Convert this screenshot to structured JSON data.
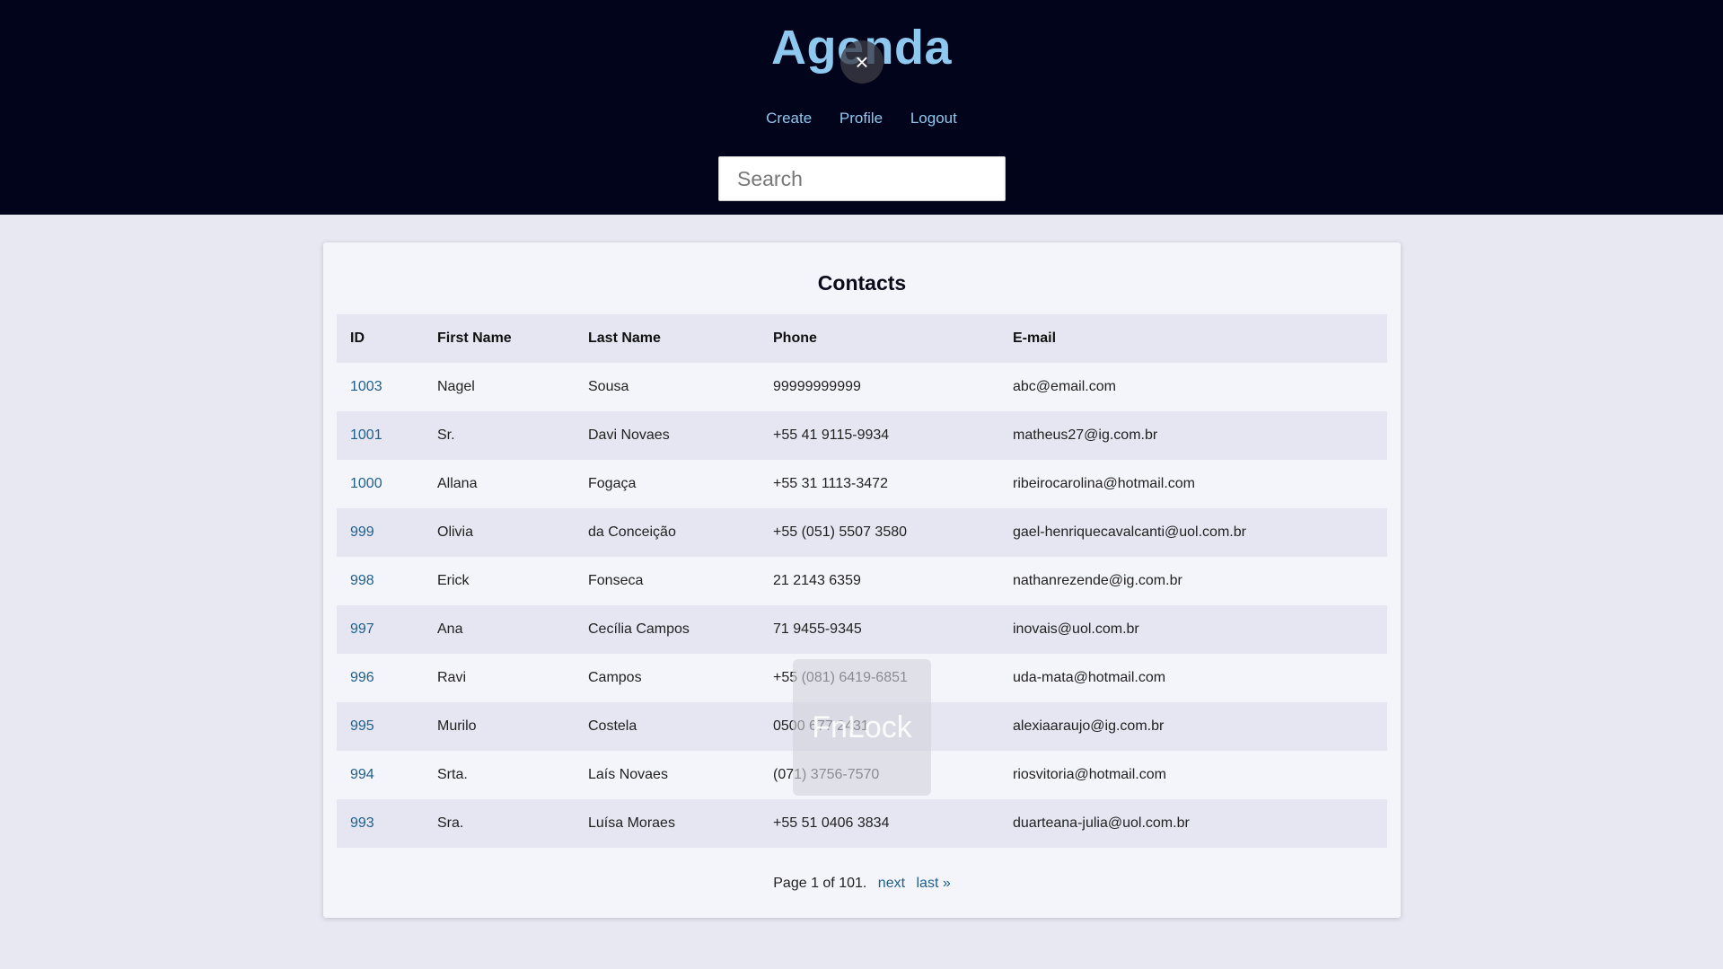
{
  "header": {
    "brand": "Agenda",
    "nav": {
      "create": "Create",
      "profile": "Profile",
      "logout": "Logout"
    },
    "search": {
      "placeholder": "Search"
    },
    "close_glyph": "×"
  },
  "main": {
    "title": "Contacts",
    "columns": [
      "ID",
      "First Name",
      "Last Name",
      "Phone",
      "E-mail"
    ],
    "rows": [
      {
        "id": "1003",
        "first": "Nagel",
        "last": "Sousa",
        "phone": "99999999999",
        "email": "abc@email.com"
      },
      {
        "id": "1001",
        "first": "Sr.",
        "last": "Davi Novaes",
        "phone": "+55 41 9115-9934",
        "email": "matheus27@ig.com.br"
      },
      {
        "id": "1000",
        "first": "Allana",
        "last": "Fogaça",
        "phone": "+55 31 1113-3472",
        "email": "ribeirocarolina@hotmail.com"
      },
      {
        "id": "999",
        "first": "Olivia",
        "last": "da Conceição",
        "phone": "+55 (051) 5507 3580",
        "email": "gael-henriquecavalcanti@uol.com.br"
      },
      {
        "id": "998",
        "first": "Erick",
        "last": "Fonseca",
        "phone": "21 2143 6359",
        "email": "nathanrezende@ig.com.br"
      },
      {
        "id": "997",
        "first": "Ana",
        "last": "Cecília Campos",
        "phone": "71 9455-9345",
        "email": "inovais@uol.com.br"
      },
      {
        "id": "996",
        "first": "Ravi",
        "last": "Campos",
        "phone": "+55 (081) 6419-6851",
        "email": "uda-mata@hotmail.com"
      },
      {
        "id": "995",
        "first": "Murilo",
        "last": "Costela",
        "phone": "0500 677 2431",
        "email": "alexiaaraujo@ig.com.br"
      },
      {
        "id": "994",
        "first": "Srta.",
        "last": "Laís Novaes",
        "phone": "(071) 3756-7570",
        "email": "riosvitoria@hotmail.com"
      },
      {
        "id": "993",
        "first": "Sra.",
        "last": "Luísa Moraes",
        "phone": "+55 51 0406 3834",
        "email": "duarteana-julia@uol.com.br"
      }
    ],
    "pagination": {
      "text": "Page 1 of 101.",
      "next": "next",
      "last": "last »"
    }
  },
  "overlay": {
    "text": "FnLock"
  },
  "colors": {
    "header_bg": "#01041a",
    "brand": "#8fc8ef",
    "link": "#1f5f8b",
    "page_bg": "#e8e8f3"
  }
}
